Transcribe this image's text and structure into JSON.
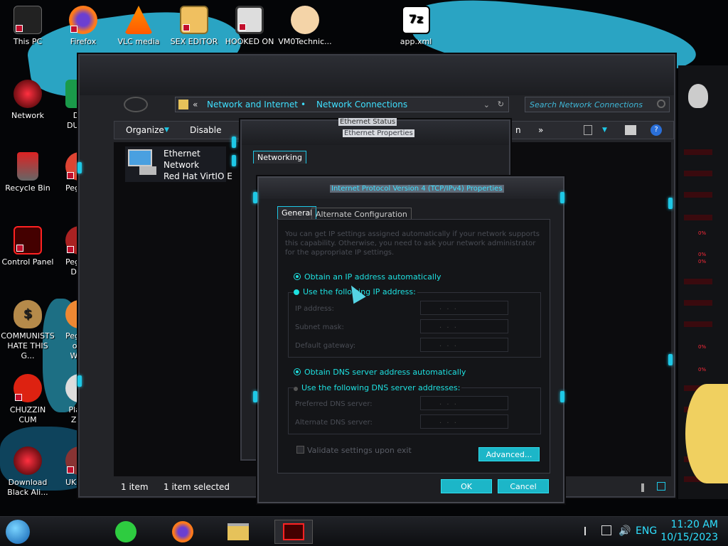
{
  "desktop_icons": [
    {
      "label": "This PC"
    },
    {
      "label": "Firefox"
    },
    {
      "label": "VLC media"
    },
    {
      "label": "SEX EDITOR"
    },
    {
      "label": "HOOKED ON"
    },
    {
      "label": "VM0Technic..."
    },
    {
      "label": "app.xml"
    },
    {
      "label": "Network"
    },
    {
      "label": "D DUM"
    },
    {
      "label": "Recycle Bin"
    },
    {
      "label": "Peggle"
    },
    {
      "label": "Control Panel"
    },
    {
      "label": "Peggle De"
    },
    {
      "label": "COMMUNISTS HATE THIS G..."
    },
    {
      "label": "Peggle of Wa"
    },
    {
      "label": "CHUZZIN CUM"
    },
    {
      "label": "Plar Zo"
    },
    {
      "label": "Download Black Ali..."
    },
    {
      "label": "UKRAINE"
    }
  ],
  "explorer": {
    "nav_back": "«",
    "breadcrumb_1": "Network and Internet",
    "breadcrumb_sep": "•",
    "breadcrumb_2": "Network Connections",
    "search_placeholder": "Search Network Connections",
    "organize": "Organize",
    "disable": "Disable",
    "cmd_n": "n",
    "cmd_more": "»",
    "file": {
      "line1": "Ethernet",
      "line2": "Network",
      "line3": "Red Hat VirtIO E"
    },
    "status_count": "1 item",
    "status_selected": "1 item selected"
  },
  "ethernet_props": {
    "title_behind": "Ethernet Status",
    "title": "Ethernet Properties",
    "tab": "Networking"
  },
  "ipv4": {
    "title": "Internet Protocol Version 4 (TCP/IPv4) Properties",
    "tab_general": "General",
    "tab_alternate": "Alternate Configuration",
    "description": "You can get IP settings assigned automatically if your network supports this capability. Otherwise, you need to ask your network administrator for the appropriate IP settings.",
    "radio_auto_ip": "Obtain an IP address automatically",
    "radio_static_ip": "Use the following IP address:",
    "ip_address_label": "IP address:",
    "subnet_label": "Subnet mask:",
    "gateway_label": "Default gateway:",
    "radio_auto_dns": "Obtain DNS server address automatically",
    "radio_static_dns": "Use the following DNS server addresses:",
    "preferred_dns_label": "Preferred DNS server:",
    "alternate_dns_label": "Alternate DNS server:",
    "ip_placeholder": ".   .   .",
    "validate_label": "Validate settings upon exit",
    "advanced_button": "Advanced...",
    "ok_button": "OK",
    "cancel_button": "Cancel"
  },
  "right_panel_readouts": [
    "0%",
    "0%",
    "0%",
    "0%",
    "0%"
  ],
  "taskbar": {
    "language": "ENG",
    "time": "11:20 AM",
    "date": "10/15/2023"
  },
  "colors": {
    "accent": "#1ec8e6",
    "accent_text": "#3fe0ff",
    "alert_red": "#ff2a3a"
  }
}
